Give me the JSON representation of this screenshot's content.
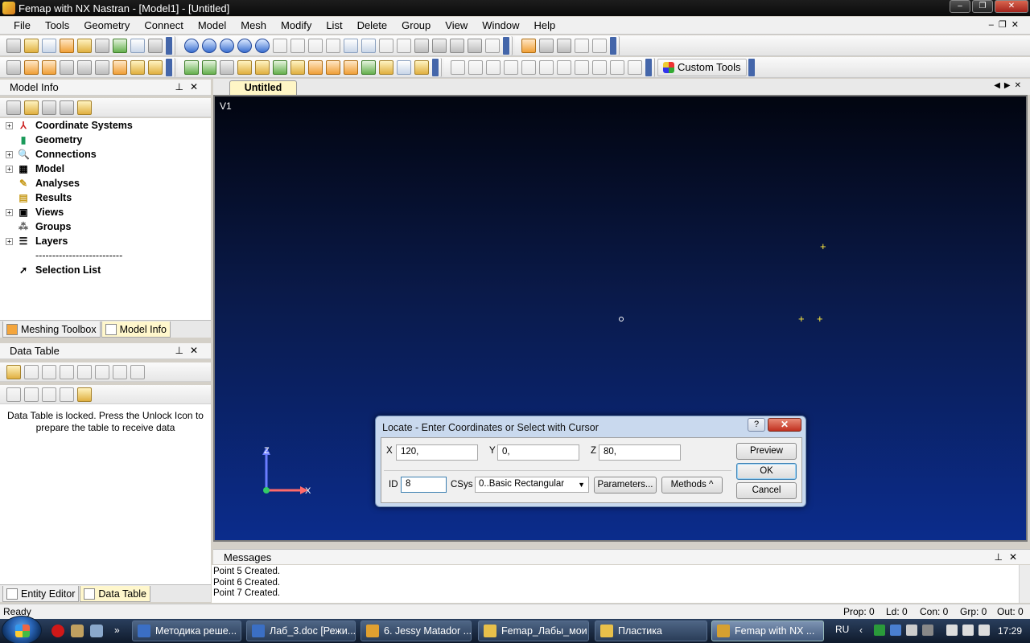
{
  "window": {
    "title": "Femap with NX Nastran - [Model1] - [Untitled]"
  },
  "menu": [
    "File",
    "Tools",
    "Geometry",
    "Connect",
    "Model",
    "Mesh",
    "Modify",
    "List",
    "Delete",
    "Group",
    "View",
    "Window",
    "Help"
  ],
  "toolbar": {
    "custom_tools_label": "Custom Tools"
  },
  "model_info": {
    "title": "Model Info",
    "tree": [
      {
        "label": "Coordinate Systems",
        "icon": "csys-icon",
        "expandable": true
      },
      {
        "label": "Geometry",
        "icon": "geometry-icon",
        "expandable": false
      },
      {
        "label": "Connections",
        "icon": "connections-icon",
        "expandable": true
      },
      {
        "label": "Model",
        "icon": "model-grid-icon",
        "expandable": true
      },
      {
        "label": "Analyses",
        "icon": "analyses-icon",
        "expandable": false
      },
      {
        "label": "Results",
        "icon": "results-icon",
        "expandable": false
      },
      {
        "label": "Views",
        "icon": "views-icon",
        "expandable": true
      },
      {
        "label": "Groups",
        "icon": "groups-icon",
        "expandable": false
      },
      {
        "label": "Layers",
        "icon": "layers-icon",
        "expandable": true
      }
    ],
    "separator": "--------------------------",
    "selection_list": "Selection List"
  },
  "left_tabs_top": [
    "Meshing Toolbox",
    "Model Info"
  ],
  "data_table": {
    "title": "Data Table",
    "locked_message": "Data Table is locked. Press the Unlock Icon to prepare the table to receive data"
  },
  "left_tabs_bottom": [
    "Entity Editor",
    "Data Table"
  ],
  "document": {
    "tab_label": "Untitled",
    "view_label": "V1"
  },
  "triad": {
    "z_label": "Z",
    "x_label": "X"
  },
  "dialog": {
    "title": "Locate - Enter Coordinates or Select with Cursor",
    "help": "?",
    "x_label": "X",
    "x_value": "120,",
    "y_label": "Y",
    "y_value": "0,",
    "z_label": "Z",
    "z_value": "80,",
    "id_label": "ID",
    "id_value": "8",
    "csys_label": "CSys",
    "csys_value": "0..Basic Rectangular",
    "parameters_button": "Parameters...",
    "methods_button": "Methods ^",
    "preview_button": "Preview",
    "ok_button": "OK",
    "cancel_button": "Cancel"
  },
  "messages": {
    "title": "Messages",
    "lines": [
      "Point 5 Created.",
      "Point 6 Created.",
      "Point 7 Created."
    ]
  },
  "status": {
    "ready": "Ready",
    "prop": "Prop: 0",
    "ld": "Ld: 0",
    "con": "Con: 0",
    "grp": "Grp: 0",
    "out": "Out: 0"
  },
  "taskbar": {
    "tasks": [
      "Методика реше...",
      "Лаб_3.doc [Режи...",
      "6. Jessy Matador ...",
      "Femap_Лабы_мои",
      "Пластика",
      "Femap with NX ..."
    ],
    "lang": "RU",
    "clock": "17:29"
  }
}
